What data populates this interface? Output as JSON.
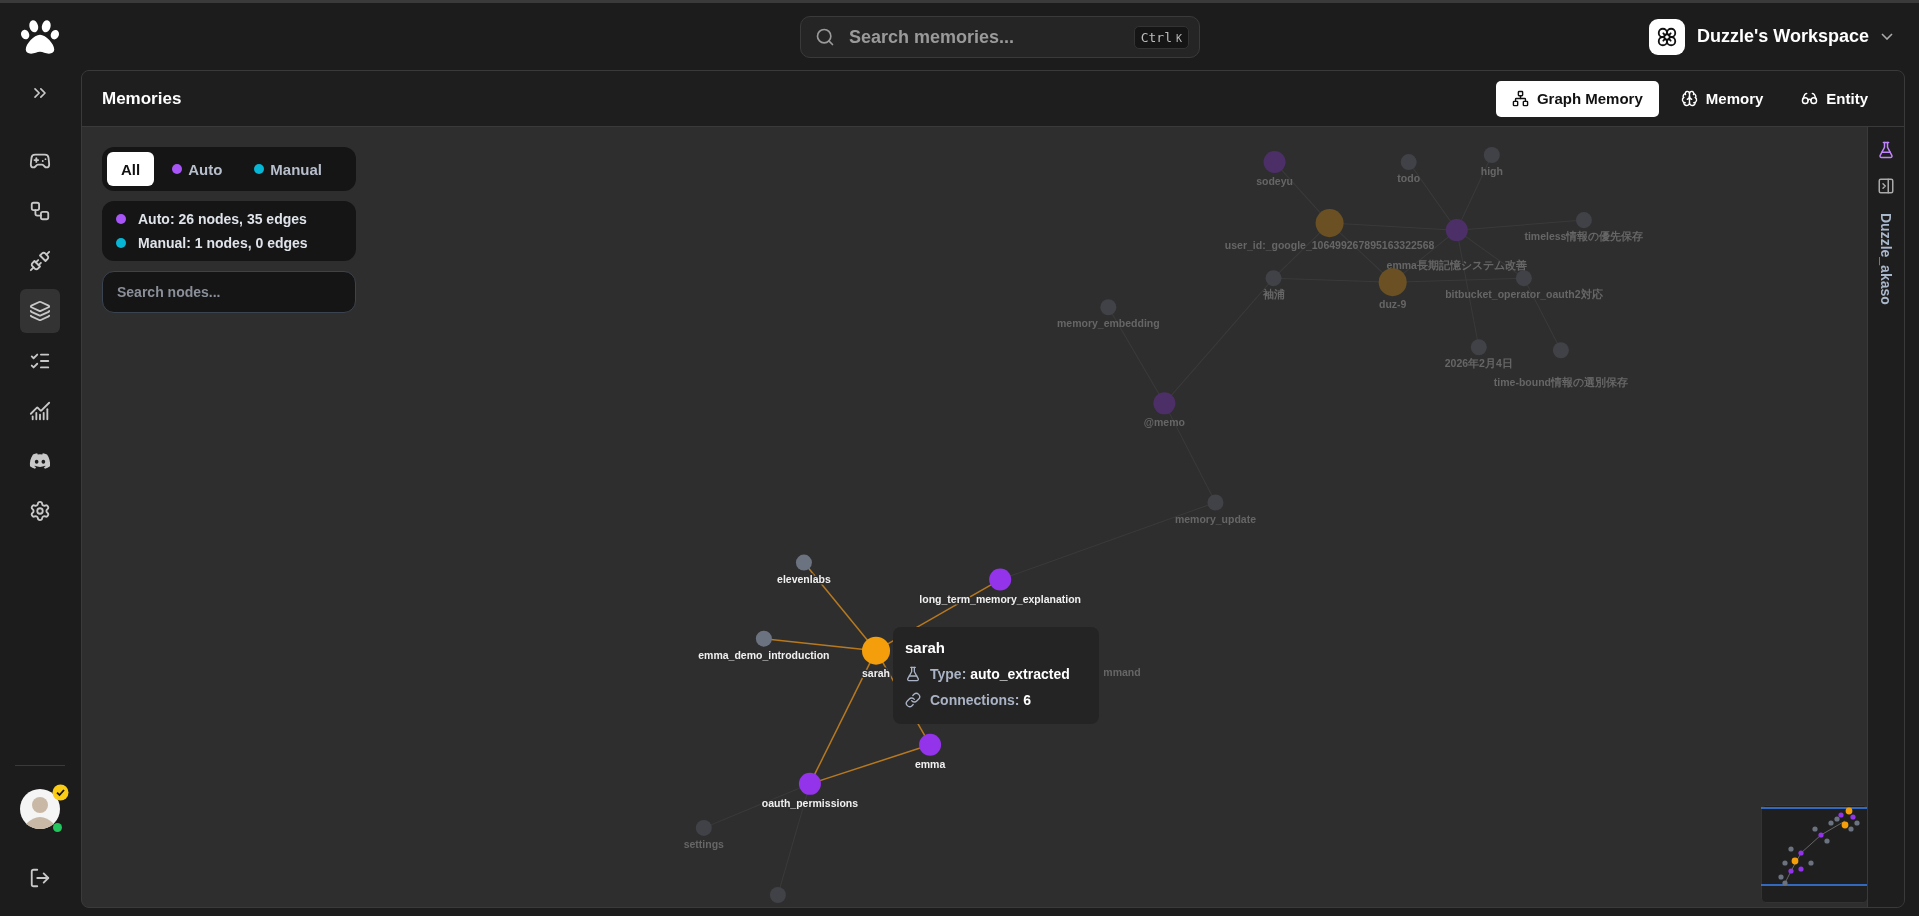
{
  "header": {
    "search": {
      "placeholder": "Search memories...",
      "keys": [
        "Ctrl",
        "K"
      ]
    },
    "workspace": {
      "name": "Duzzle's Workspace"
    }
  },
  "sidebar": {
    "items": [
      {
        "selected": false
      },
      {
        "selected": false
      },
      {
        "selected": false
      },
      {
        "selected": true
      },
      {
        "selected": false
      },
      {
        "selected": false
      },
      {
        "selected": false
      },
      {
        "selected": false
      }
    ]
  },
  "panel": {
    "title": "Memories",
    "view_tabs": [
      {
        "label": "Graph Memory",
        "selected": true
      },
      {
        "label": "Memory",
        "selected": false
      },
      {
        "label": "Entity",
        "selected": false
      }
    ],
    "filter_tabs": [
      {
        "label": "All",
        "selected": true
      },
      {
        "label": "Auto",
        "selected": false,
        "color": "#a855f7"
      },
      {
        "label": "Manual",
        "selected": false,
        "color": "#06b6d4"
      }
    ],
    "stats": [
      {
        "text": "Auto: 26 nodes, 35 edges",
        "color": "#a855f7"
      },
      {
        "text": "Manual: 1 nodes, 0 edges",
        "color": "#06b6d4"
      }
    ],
    "node_search": {
      "placeholder": "Search nodes..."
    },
    "graph": {
      "nodes": [
        {
          "label": "sodeyu",
          "kind": "memory",
          "dimmed": true
        },
        {
          "label": "todo",
          "kind": "entity",
          "dimmed": true
        },
        {
          "label": "high",
          "kind": "entity",
          "dimmed": true
        },
        {
          "label": "user_id:_google_106499267895163322568",
          "kind": "user",
          "dimmed": true
        },
        {
          "label": "emma長期記憶システム改善",
          "kind": "memory",
          "dimmed": true
        },
        {
          "label": "timeless情報の優先保存",
          "kind": "entity",
          "dimmed": true
        },
        {
          "label": "袖浦",
          "kind": "entity",
          "dimmed": true
        },
        {
          "label": "duz-9",
          "kind": "user",
          "dimmed": true
        },
        {
          "label": "bitbucket_operator_oauth2対応",
          "kind": "entity",
          "dimmed": true
        },
        {
          "label": "memory_embedding",
          "kind": "entity",
          "dimmed": true
        },
        {
          "label": "2026年2月4日",
          "kind": "entity",
          "dimmed": true
        },
        {
          "label": "time-bound情報の選別保存",
          "kind": "entity",
          "dimmed": true
        },
        {
          "label": "@memo",
          "kind": "memory",
          "dimmed": true
        },
        {
          "label": "memory_update",
          "kind": "entity",
          "dimmed": true
        },
        {
          "label": "elevenlabs",
          "kind": "entity",
          "dimmed": false
        },
        {
          "label": "long_term_memory_explanation",
          "kind": "memory",
          "dimmed": false
        },
        {
          "label": "emma_demo_introduction",
          "kind": "entity",
          "dimmed": false
        },
        {
          "label": "sarah",
          "kind": "user",
          "dimmed": false
        },
        {
          "label": "emma",
          "kind": "memory",
          "dimmed": false
        },
        {
          "label": "oauth_permissions",
          "kind": "memory",
          "dimmed": false
        },
        {
          "label": "settings",
          "kind": "entity",
          "dimmed": true
        },
        {
          "kind": "entity",
          "dimmed": true
        }
      ],
      "hidden_label": "mmand",
      "tooltip": {
        "title": "sarah",
        "rows": [
          {
            "kind": "type",
            "label": "Type:",
            "value": "auto_extracted"
          },
          {
            "kind": "connections",
            "label": "Connections:",
            "value": "6"
          }
        ]
      }
    },
    "side_rail": {
      "user": "Duzzle_akaso"
    }
  }
}
